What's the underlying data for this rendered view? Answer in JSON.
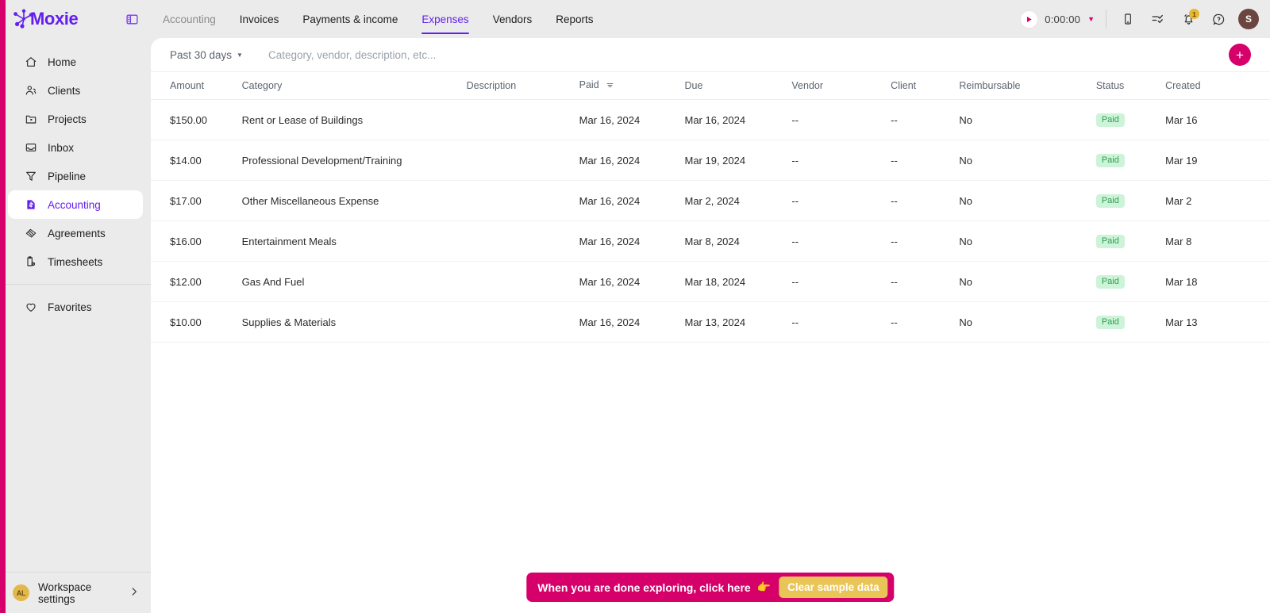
{
  "brand": {
    "name": "Moxie",
    "purple": "#6320ee",
    "pink": "#d6006b"
  },
  "sidebar": {
    "items": [
      {
        "label": "Home",
        "icon": "home-icon",
        "active": false
      },
      {
        "label": "Clients",
        "icon": "people-icon",
        "active": false
      },
      {
        "label": "Projects",
        "icon": "folder-icon",
        "active": false
      },
      {
        "label": "Inbox",
        "icon": "inbox-icon",
        "active": false
      },
      {
        "label": "Pipeline",
        "icon": "funnel-icon",
        "active": false
      },
      {
        "label": "Accounting",
        "icon": "receipt-icon",
        "active": true
      },
      {
        "label": "Agreements",
        "icon": "handshake-icon",
        "active": false
      },
      {
        "label": "Timesheets",
        "icon": "clipboard-clock-icon",
        "active": false
      }
    ],
    "favorites": {
      "label": "Favorites",
      "icon": "heart-icon"
    },
    "workspace": {
      "avatar_initials": "AL",
      "label": "Workspace settings",
      "chevron": "chevron-right-icon"
    }
  },
  "topbar": {
    "panel_toggle": "panel-toggle-icon",
    "tabs": [
      {
        "label": "Accounting",
        "state": "muted"
      },
      {
        "label": "Invoices",
        "state": "normal"
      },
      {
        "label": "Payments & income",
        "state": "normal"
      },
      {
        "label": "Expenses",
        "state": "active"
      },
      {
        "label": "Vendors",
        "state": "normal"
      },
      {
        "label": "Reports",
        "state": "normal"
      }
    ],
    "timer": {
      "play_icon": "play-icon",
      "value": "0:00:00",
      "caret": "caret-down-icon"
    },
    "icons": [
      {
        "name": "mobile-icon"
      },
      {
        "name": "tasks-checklist-icon"
      },
      {
        "name": "bell-icon",
        "badge": "1"
      },
      {
        "name": "help-circle-icon"
      }
    ],
    "avatar_initials": "S"
  },
  "filters": {
    "date_range": "Past 30 days",
    "search_placeholder": "Category, vendor, description, etc...",
    "search_value": "",
    "add_button": "+"
  },
  "table": {
    "columns": [
      "Amount",
      "Category",
      "Description",
      "Paid",
      "Due",
      "Vendor",
      "Client",
      "Reimbursable",
      "Status",
      "Created"
    ],
    "sorted_column": "Paid",
    "rows": [
      {
        "amount": "$150.00",
        "category": "Rent or Lease of Buildings",
        "description": "",
        "paid": "Mar 16, 2024",
        "due": "Mar 16, 2024",
        "vendor": "--",
        "client": "--",
        "reimbursable": "No",
        "status": "Paid",
        "created": "Mar 16"
      },
      {
        "amount": "$14.00",
        "category": "Professional Development/Training",
        "description": "",
        "paid": "Mar 16, 2024",
        "due": "Mar 19, 2024",
        "vendor": "--",
        "client": "--",
        "reimbursable": "No",
        "status": "Paid",
        "created": "Mar 19"
      },
      {
        "amount": "$17.00",
        "category": "Other Miscellaneous Expense",
        "description": "",
        "paid": "Mar 16, 2024",
        "due": "Mar 2, 2024",
        "vendor": "--",
        "client": "--",
        "reimbursable": "No",
        "status": "Paid",
        "created": "Mar 2"
      },
      {
        "amount": "$16.00",
        "category": "Entertainment Meals",
        "description": "",
        "paid": "Mar 16, 2024",
        "due": "Mar 8, 2024",
        "vendor": "--",
        "client": "--",
        "reimbursable": "No",
        "status": "Paid",
        "created": "Mar 8"
      },
      {
        "amount": "$12.00",
        "category": "Gas And Fuel",
        "description": "",
        "paid": "Mar 16, 2024",
        "due": "Mar 18, 2024",
        "vendor": "--",
        "client": "--",
        "reimbursable": "No",
        "status": "Paid",
        "created": "Mar 18"
      },
      {
        "amount": "$10.00",
        "category": "Supplies & Materials",
        "description": "",
        "paid": "Mar 16, 2024",
        "due": "Mar 13, 2024",
        "vendor": "--",
        "client": "--",
        "reimbursable": "No",
        "status": "Paid",
        "created": "Mar 13"
      }
    ]
  },
  "banner": {
    "message": "When you are done exploring, click here",
    "finger": "👉",
    "button_label": "Clear sample data"
  }
}
